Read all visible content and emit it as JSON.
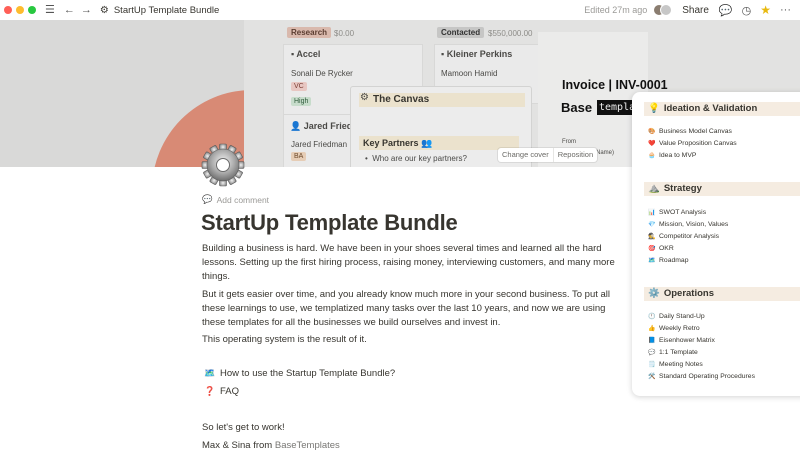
{
  "window": {
    "title": "StartUp Template Bundle",
    "edited": "Edited 27m ago",
    "share": "Share"
  },
  "cover": {
    "research_tag": "Research",
    "research_amount": "$0.00",
    "contacted_tag": "Contacted",
    "contacted_amount": "$550,000.00",
    "accel_name": "Accel",
    "accel_person": "Sonali De Rycker",
    "vc_tag": "VC",
    "high_tag": "High",
    "jared_name": "Jared Friedm",
    "jared_person": "Jared Friedman",
    "ba_tag": "BA",
    "kp_name": "Kleiner Perkins",
    "kp_person": "Mamoon Hamid",
    "canvas_title": "The Canvas",
    "key_partners": "Key Partners 👥",
    "key_partners_q": "Who are our key partners?",
    "invoice_title": "Invoice | INV-0001",
    "base_text": "Base",
    "base_tag": "templa",
    "from_label": "From",
    "company_name": "ny Name)",
    "change_cover": "Change cover",
    "reposition": "Reposition"
  },
  "content": {
    "add_comment": "Add comment",
    "title": "StartUp Template Bundle",
    "p1": "Building a business is hard. We have been in your shoes several times and learned all the hard lessons. Setting up the first hiring process, raising money, interviewing customers, and many more things.",
    "p2": "But it gets easier over time, and you already know much more in your second business. To put all these learnings to use, we templatized many tasks over the last 10 years, and now we are using these templates for all the businesses we build ourselves and invest in.",
    "p3": "This operating system is the result of it.",
    "link1": "How to use the Startup Template Bundle?",
    "link2": "FAQ",
    "p4": "So let's get to work!",
    "sign_prefix": "Max & Sina from ",
    "sign_link": "BaseTemplates"
  },
  "sidebar": {
    "sections": [
      {
        "title": "Ideation & Validation",
        "icon": "lightbulb-icon",
        "items": [
          {
            "icon": "🎨",
            "label": "Business Model Canvas"
          },
          {
            "icon": "❤️",
            "label": "Value Proposition Canvas"
          },
          {
            "icon": "🧁",
            "label": "Idea to MVP"
          }
        ]
      },
      {
        "title": "Strategy",
        "icon": "mountain-icon",
        "items": [
          {
            "icon": "📊",
            "label": "SWOT Analysis"
          },
          {
            "icon": "💎",
            "label": "Mission, Vision, Values"
          },
          {
            "icon": "🕵️",
            "label": "Competitor Analysis"
          },
          {
            "icon": "🎯",
            "label": "OKR"
          },
          {
            "icon": "🗺️",
            "label": "Roadmap"
          }
        ]
      },
      {
        "title": "Operations",
        "icon": "gear-icon",
        "items": [
          {
            "icon": "🕛",
            "label": "Daily Stand-Up"
          },
          {
            "icon": "👍",
            "label": "Weekly Retro"
          },
          {
            "icon": "📘",
            "label": "Eisenhower Matrix"
          },
          {
            "icon": "💬",
            "label": "1:1 Template"
          },
          {
            "icon": "🗒️",
            "label": "Meeting Notes"
          },
          {
            "icon": "🛠️",
            "label": "Standard Operating Procedures"
          }
        ]
      }
    ]
  }
}
